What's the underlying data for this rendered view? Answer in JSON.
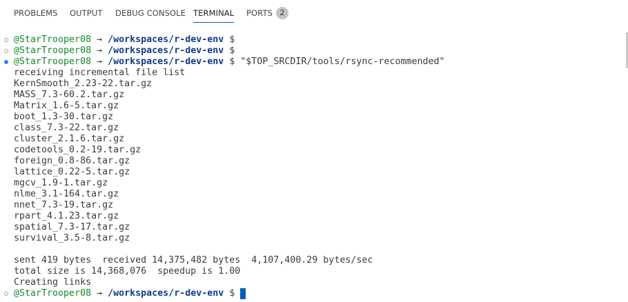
{
  "tabs": [
    {
      "label": "PROBLEMS"
    },
    {
      "label": "OUTPUT"
    },
    {
      "label": "DEBUG CONSOLE"
    },
    {
      "label": "TERMINAL",
      "active": true
    },
    {
      "label": "PORTS",
      "badge": "2"
    }
  ],
  "prompt": {
    "user": "@StarTrooper08",
    "arrow": "→",
    "path": "/workspaces/r-dev-env",
    "symbol": "$"
  },
  "command": " \"$TOP_SRCDIR/tools/rsync-recommended\"",
  "output": [
    "receiving incremental file list",
    "KernSmooth_2.23-22.tar.gz",
    "MASS_7.3-60.2.tar.gz",
    "Matrix_1.6-5.tar.gz",
    "boot_1.3-30.tar.gz",
    "class_7.3-22.tar.gz",
    "cluster_2.1.6.tar.gz",
    "codetools_0.2-19.tar.gz",
    "foreign_0.8-86.tar.gz",
    "lattice_0.22-5.tar.gz",
    "mgcv_1.9-1.tar.gz",
    "nlme_3.1-164.tar.gz",
    "nnet_7.3-19.tar.gz",
    "rpart_4.1.23.tar.gz",
    "spatial_7.3-17.tar.gz",
    "survival_3.5-8.tar.gz",
    "",
    "sent 419 bytes  received 14,375,482 bytes  4,107,400.29 bytes/sec",
    "total size is 14,368,076  speedup is 1.00",
    "Creating links"
  ],
  "colors": {
    "user": "#148a2a",
    "path": "#0f3a8c",
    "accent": "#005fb8",
    "decoration_active": "#1a85ff"
  },
  "icons": {
    "command_decoration_default": "hollow-circle",
    "command_decoration_success": "filled-circle"
  }
}
